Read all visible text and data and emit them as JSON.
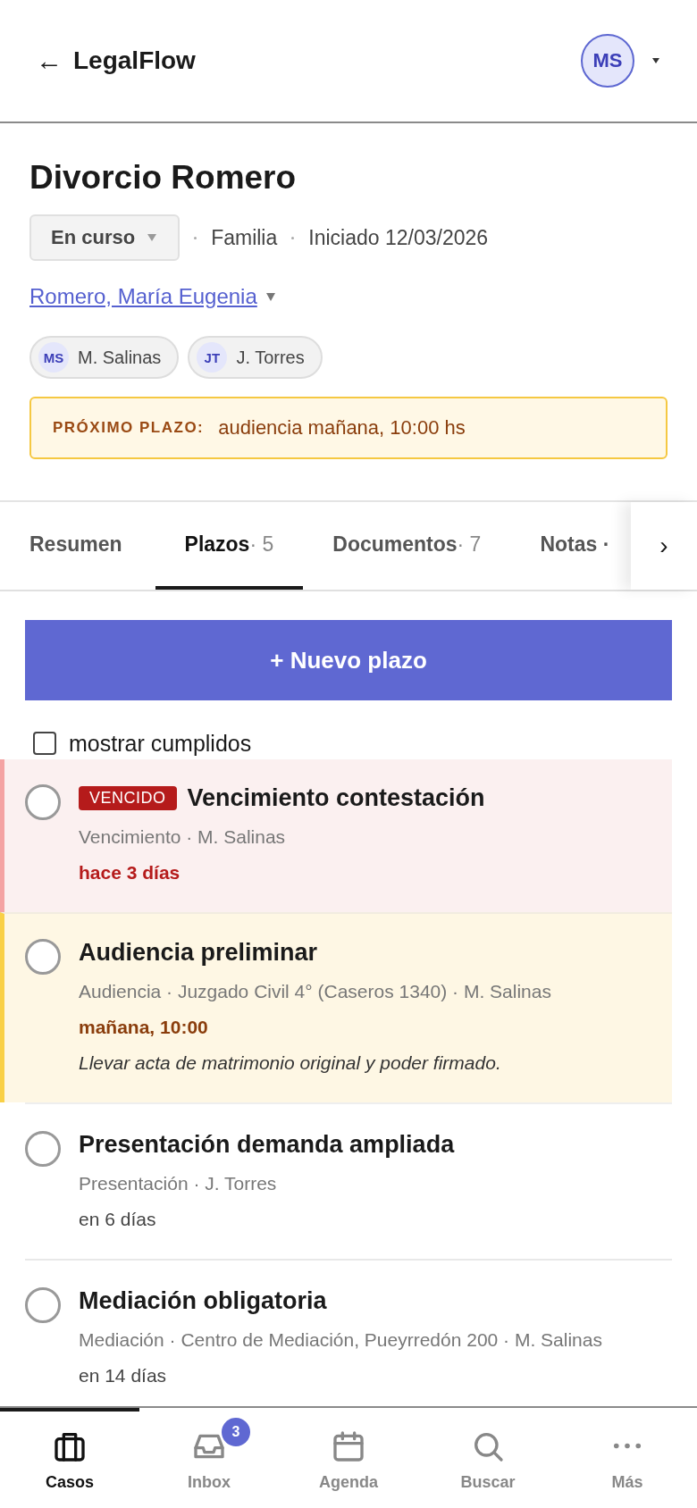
{
  "header": {
    "back": "←",
    "brand": "LegalFlow",
    "avatar": "MS"
  },
  "case": {
    "title": "Divorcio Romero",
    "status": "En curso",
    "meta": [
      "Familia",
      "Iniciado 12/03/2026"
    ],
    "client": "Romero, María Eugenia",
    "team": [
      {
        "initials": "MS",
        "name": "M. Salinas"
      },
      {
        "initials": "JT",
        "name": "J. Torres"
      }
    ],
    "next_deadline": {
      "label": "PRÓXIMO PLAZO:",
      "text": "audiencia mañana, 10:00 hs"
    }
  },
  "tabs": [
    {
      "label": "Resumen",
      "selected": false
    },
    {
      "label": "Plazos",
      "count": "· 5",
      "selected": true
    },
    {
      "label": "Documentos",
      "count": "· 7",
      "selected": false
    },
    {
      "label": "Notas ·",
      "selected": false
    }
  ],
  "tabs_scroll": "›",
  "new_button": "+ Nuevo plazo",
  "show_done": {
    "label": "mostrar cumplidos",
    "checked": false
  },
  "deadlines": [
    {
      "kind": "overdue",
      "badge": "VENCIDO",
      "title": "Vencimiento contestación",
      "meta": "Vencimiento · M. Salinas",
      "due": "hace 3 días",
      "done": false
    },
    {
      "kind": "soon",
      "title": "Audiencia preliminar",
      "meta": "Audiencia · Juzgado Civil 4° (Caseros 1340) · M. Salinas",
      "due": "mañana, 10:00",
      "note": "Llevar acta de matrimonio original y poder firmado.",
      "done": false
    },
    {
      "kind": "normal",
      "title": "Presentación demanda ampliada",
      "meta": "Presentación · J. Torres",
      "due": "en 6 días",
      "done": false
    },
    {
      "kind": "normal",
      "title": "Mediación obligatoria",
      "meta": "Mediación · Centro de Mediación, Pueyrredón 200 · M. Salinas",
      "due": "en 14 días",
      "done": false
    }
  ],
  "nav": [
    {
      "kind": "cases",
      "label": "Casos",
      "selected": true
    },
    {
      "kind": "inbox",
      "label": "Inbox",
      "badge": "3",
      "selected": false
    },
    {
      "kind": "agenda",
      "label": "Agenda",
      "selected": false
    },
    {
      "kind": "search",
      "label": "Buscar",
      "selected": false
    },
    {
      "kind": "more",
      "label": "Más",
      "selected": false
    }
  ]
}
